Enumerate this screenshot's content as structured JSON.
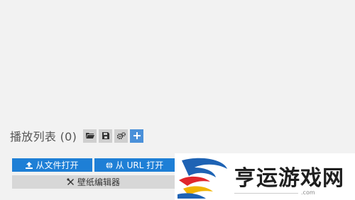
{
  "playlist": {
    "title": "播放列表 (0)",
    "tools": [
      {
        "name": "folder-icon"
      },
      {
        "name": "save-icon"
      },
      {
        "name": "gears-icon"
      },
      {
        "name": "plus-icon"
      }
    ]
  },
  "buttons": {
    "open_file": "从文件打开",
    "open_url": "从 URL 打开",
    "wallpaper_editor": "壁纸编辑器"
  },
  "watermark": {
    "text": "亨运游戏网",
    "suffix": ".com"
  },
  "colors": {
    "primary": "#1e7fd6",
    "tool_gray": "#cfcfcf",
    "tool_accent": "#4a90d9",
    "background": "#f2f2f2"
  }
}
